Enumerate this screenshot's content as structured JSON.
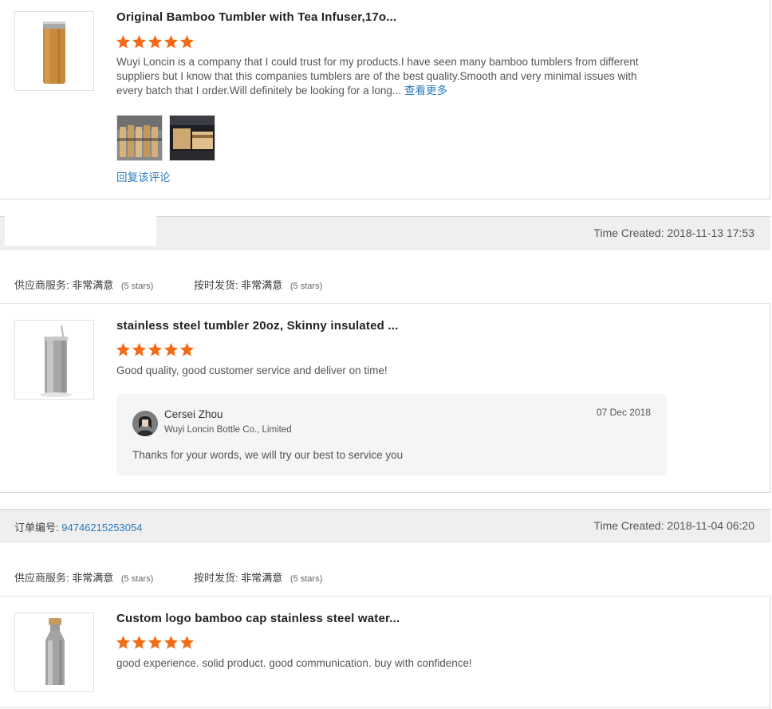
{
  "reviews": [
    {
      "title": "Original Bamboo Tumbler with Tea Infuser,17o...",
      "rating": 5,
      "text": "Wuyi Loncin is a company that I could trust for my products.I have seen many bamboo tumblers from different suppliers but I know that this companies tumblers are of the best quality.Smooth and very minimal issues with every batch that I order.Will definitely be looking for a long...",
      "more_link": "查看更多",
      "reply_link": "回复该评论",
      "photo_count": 2
    },
    {
      "title": "stainless steel tumbler 20oz, Skinny insulated ...",
      "rating": 5,
      "text": "Good quality, good customer service and deliver on time!",
      "reply": {
        "name": "Cersei Zhou",
        "company": "Wuyi Loncin Bottle Co., Limited",
        "date": "07 Dec 2018",
        "text": "Thanks for your words, we will try our best to service you"
      }
    },
    {
      "title": "Custom logo bamboo cap stainless steel water...",
      "rating": 5,
      "text": "good experience.  solid product. good communication. buy with confidence!"
    }
  ],
  "orders": [
    {
      "order_label": "",
      "order_number": "",
      "time_created": "Time Created: 2018-11-13 17:53",
      "supplier_service_label": "供应商服务:",
      "supplier_service_value": "非常满意",
      "supplier_service_stars": "(5 stars)",
      "on_time_label": "按时发货:",
      "on_time_value": "非常满意",
      "on_time_stars": "(5 stars)"
    },
    {
      "order_label": "订单编号:",
      "order_number": "94746215253054",
      "time_created": "Time Created: 2018-11-04 06:20",
      "supplier_service_label": "供应商服务:",
      "supplier_service_value": "非常满意",
      "supplier_service_stars": "(5 stars)",
      "on_time_label": "按时发货:",
      "on_time_value": "非常满意",
      "on_time_stars": "(5 stars)"
    }
  ],
  "colors": {
    "star": "#f56a16",
    "link": "#2a7bbf",
    "header_bg": "#efefef"
  }
}
